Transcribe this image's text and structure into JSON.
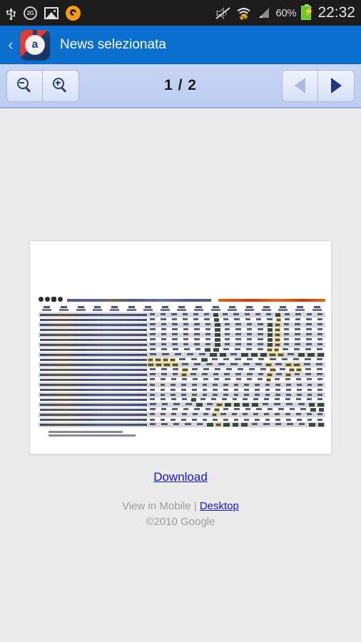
{
  "status_bar": {
    "left_icons": [
      {
        "name": "usb-icon",
        "glyph": "Ψ"
      },
      {
        "name": "network-2g-icon",
        "label": "2G"
      },
      {
        "name": "gallery-image-icon",
        "glyph": ""
      },
      {
        "name": "sync-icon",
        "glyph": ""
      }
    ],
    "right": {
      "mute-icon": "✇",
      "wifi-transfer-icon": "wifi",
      "signal-icon": "signal",
      "battery_percent": "60%",
      "battery-icon": "battery-charging",
      "clock": "22:32"
    }
  },
  "app_bar": {
    "back_label": "‹",
    "icon_letter": "a",
    "title": "News selezionata",
    "background_color": "#0b6fd0"
  },
  "viewer_toolbar": {
    "zoom_out_label": "zoom-out",
    "zoom_in_label": "zoom-in",
    "page_indicator": "1 / 2",
    "prev_label": "prev",
    "next_label": "next",
    "prev_enabled": "false",
    "next_enabled": "true"
  },
  "document_preview": {
    "alt": "scanned spreadsheet page preview",
    "columns": 17,
    "rows": 22
  },
  "actions": {
    "download_label": "Download"
  },
  "footer": {
    "view_in_label": "View in Mobile | ",
    "desktop_link": "Desktop",
    "copyright": "©2010 Google"
  }
}
